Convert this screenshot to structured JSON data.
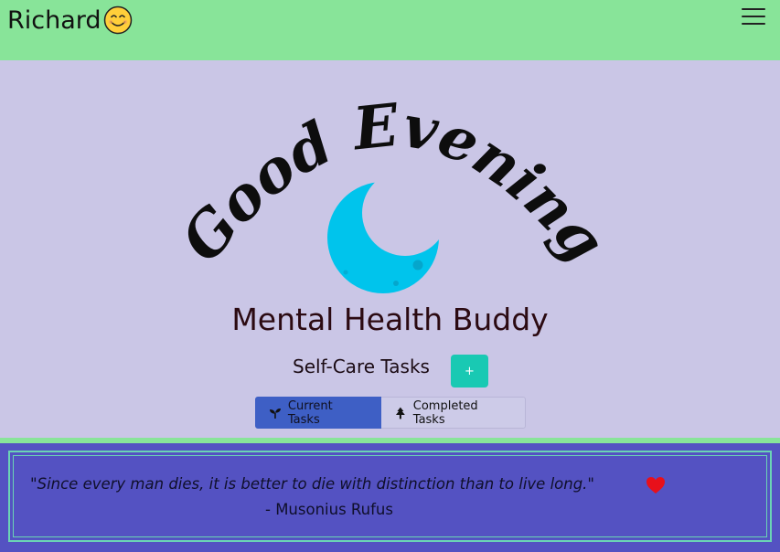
{
  "header": {
    "username": "Richard",
    "menu_icon": "hamburger-icon",
    "avatar_icon": "smiley-face-icon"
  },
  "greeting": {
    "text": "Good Evening",
    "icon": "crescent-moon-icon",
    "moon_color": "#00c4ec"
  },
  "app_title": "Mental Health Buddy",
  "tasks": {
    "heading": "Self-Care Tasks",
    "add_label": "+",
    "tabs": [
      {
        "label": "Current Tasks",
        "icon": "seedling-icon",
        "active": true
      },
      {
        "label": "Completed Tasks",
        "icon": "tree-icon",
        "active": false
      }
    ]
  },
  "quote": {
    "text": "\"Since every man dies, it is better to die with distinction than to live long.\"",
    "author": "- Musonius Rufus",
    "favorite_icon": "heart-icon"
  },
  "colors": {
    "header_bg": "#88e499",
    "page_bg": "#cac6e6",
    "add_button": "#19c9b3",
    "active_tab": "#3e5fc5",
    "quote_bg": "#5452c2",
    "heart": "#e8101a"
  }
}
